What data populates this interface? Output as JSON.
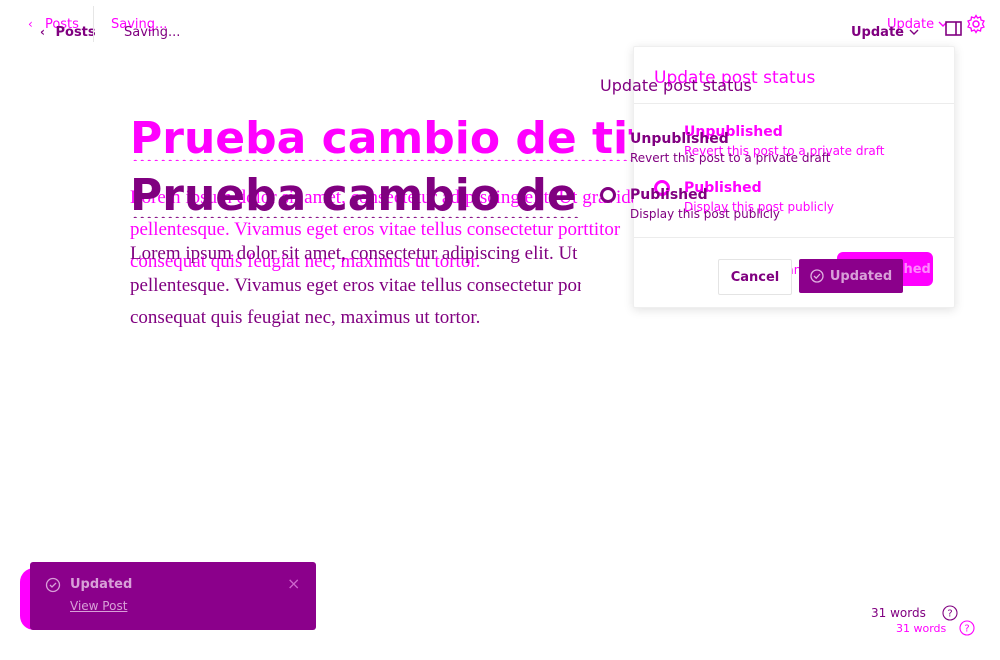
{
  "topbar": {
    "back_label": "Posts",
    "save_status": "Saving...",
    "update_label": "Update"
  },
  "editor": {
    "title": "Prueba cambio de titulo",
    "paragraph_lines": [
      "Lorem ipsum dolor sit amet, consectetur adipiscing elit. Ut gravida",
      "pellentesque. Vivamus eget eros vitae tellus consectetur porttitor",
      "consequat quis feugiat nec, maximus ut tortor."
    ]
  },
  "status_panel": {
    "heading": "Update post status",
    "options": [
      {
        "label": "Unpublished",
        "description": "Revert this post to a private draft",
        "selected": false
      },
      {
        "label": "Published",
        "description": "Display this post publicly",
        "selected": true
      }
    ],
    "cancel_label": "Cancel",
    "confirm_label": "Updated",
    "ghost_confirm_label": "Unpublished"
  },
  "toast": {
    "title": "Updated",
    "link": "View Post"
  },
  "footer": {
    "word_count": "31 words"
  },
  "colors": {
    "accent": "#800080",
    "ghost": "#ff00ff",
    "toast": "#8b008b"
  },
  "icons": {
    "back": "chevron-left-icon",
    "update_menu": "chevron-down-icon",
    "sidebar": "sidebar-panel-icon",
    "settings": "gear-icon",
    "check": "check-circle-icon",
    "close": "close-icon",
    "help": "help-circle-icon"
  }
}
